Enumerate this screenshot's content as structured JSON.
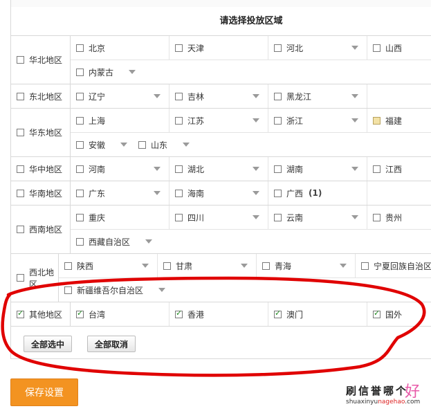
{
  "title": "请选择投放区域",
  "regions": [
    {
      "label": "华北地区",
      "checked": false,
      "lines": [
        [
          {
            "name": "北京",
            "checked": false
          },
          {
            "name": "天津",
            "checked": false
          },
          {
            "name": "河北",
            "checked": false,
            "dropdown": true
          },
          {
            "name": "山西",
            "checked": false
          }
        ],
        [
          {
            "name": "内蒙古",
            "checked": false,
            "dropdown": true
          }
        ]
      ]
    },
    {
      "label": "东北地区",
      "checked": false,
      "lines": [
        [
          {
            "name": "辽宁",
            "checked": false,
            "dropdown": true
          },
          {
            "name": "吉林",
            "checked": false,
            "dropdown": true
          },
          {
            "name": "黑龙江",
            "checked": false,
            "dropdown": true
          }
        ]
      ]
    },
    {
      "label": "华东地区",
      "checked": false,
      "lines": [
        [
          {
            "name": "上海",
            "checked": false
          },
          {
            "name": "江苏",
            "checked": false,
            "dropdown": true
          },
          {
            "name": "浙江",
            "checked": false,
            "dropdown": true
          },
          {
            "name": "福建",
            "checked": false,
            "highlight": true
          }
        ],
        [
          {
            "name": "安徽",
            "checked": false,
            "dropdown": true
          },
          {
            "name": "山东",
            "checked": false,
            "dropdown": true
          }
        ]
      ]
    },
    {
      "label": "华中地区",
      "checked": false,
      "lines": [
        [
          {
            "name": "河南",
            "checked": false,
            "dropdown": true
          },
          {
            "name": "湖北",
            "checked": false,
            "dropdown": true
          },
          {
            "name": "湖南",
            "checked": false,
            "dropdown": true
          },
          {
            "name": "江西",
            "checked": false
          }
        ]
      ]
    },
    {
      "label": "华南地区",
      "checked": false,
      "lines": [
        [
          {
            "name": "广东",
            "checked": false,
            "dropdown": true
          },
          {
            "name": "海南",
            "checked": false,
            "dropdown": true
          },
          {
            "name": "广西",
            "checked": false,
            "count": "(1)"
          }
        ]
      ]
    },
    {
      "label": "西南地区",
      "checked": false,
      "lines": [
        [
          {
            "name": "重庆",
            "checked": false
          },
          {
            "name": "四川",
            "checked": false,
            "dropdown": true
          },
          {
            "name": "云南",
            "checked": false,
            "dropdown": true
          },
          {
            "name": "贵州",
            "checked": false
          }
        ],
        [
          {
            "name": "西藏自治区",
            "checked": false,
            "dropdown": true
          }
        ]
      ]
    },
    {
      "label": "西北地区",
      "checked": false,
      "lines": [
        [
          {
            "name": "陕西",
            "checked": false,
            "dropdown": true
          },
          {
            "name": "甘肃",
            "checked": false,
            "dropdown": true
          },
          {
            "name": "青海",
            "checked": false,
            "dropdown": true
          },
          {
            "name": "宁夏回族自治区",
            "checked": false
          }
        ],
        [
          {
            "name": "新疆维吾尔自治区",
            "checked": false,
            "dropdown": true
          }
        ]
      ]
    },
    {
      "label": "其他地区",
      "checked": true,
      "lines": [
        [
          {
            "name": "台湾",
            "checked": true
          },
          {
            "name": "香港",
            "checked": true
          },
          {
            "name": "澳门",
            "checked": true
          },
          {
            "name": "国外",
            "checked": true
          }
        ]
      ]
    }
  ],
  "buttons": {
    "select_all": "全部选中",
    "deselect_all": "全部取消"
  },
  "save_button": "保存设置",
  "watermark": {
    "cn": "刷信誉哪个",
    "cn_big": "好",
    "url_a": "shuaxinyu",
    "url_b": "nagehao",
    "url_c": ".com"
  },
  "colors": {
    "accent": "#f39321",
    "annotation": "#e00000",
    "check": "#1e8a1e",
    "highlight": "#f3e2a6"
  }
}
